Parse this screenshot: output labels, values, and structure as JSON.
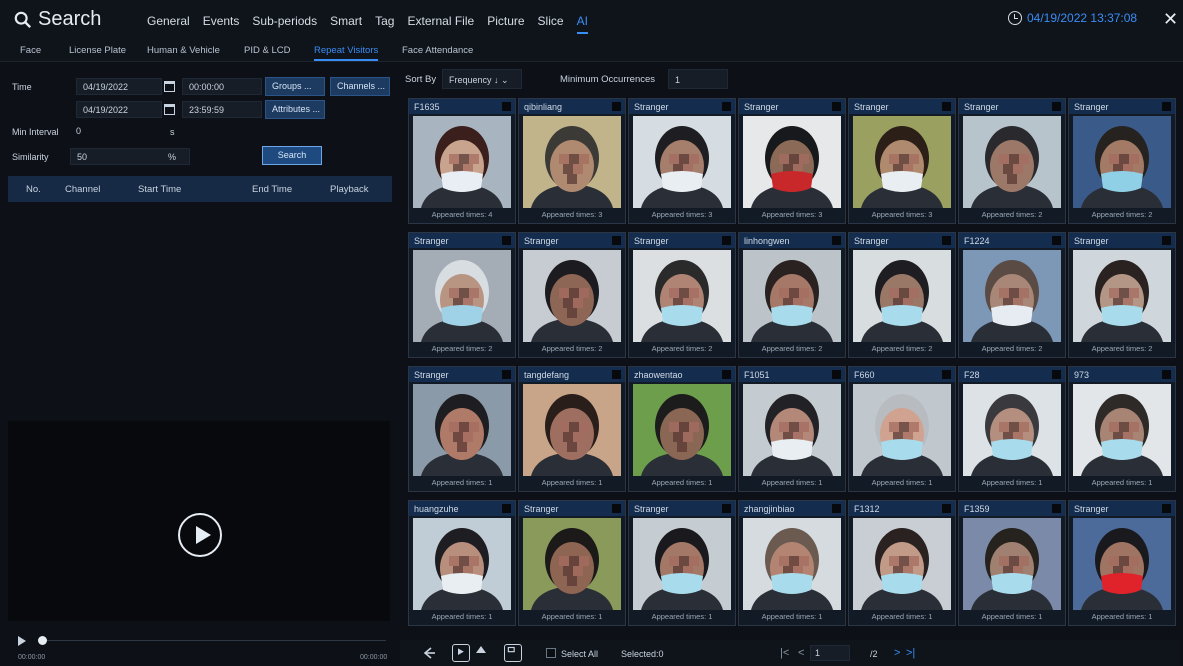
{
  "header": {
    "title": "Search",
    "tabs": [
      "General",
      "Events",
      "Sub-periods",
      "Smart",
      "Tag",
      "External File",
      "Picture",
      "Slice",
      "AI"
    ],
    "active_tab": "AI",
    "datetime": "04/19/2022 13:37:08"
  },
  "subtabs": {
    "items": [
      "Face",
      "License Plate",
      "Human & Vehicle",
      "PID & LCD",
      "Repeat Visitors",
      "Face Attendance"
    ],
    "active": "Repeat Visitors"
  },
  "filters": {
    "time_label": "Time",
    "start_date": "04/19/2022",
    "start_time": "00:00:00",
    "end_date": "04/19/2022",
    "end_time": "23:59:59",
    "groups_button": "Groups ...",
    "channels_button": "Channels ...",
    "attributes_button": "Attributes ...",
    "min_interval_label": "Min Interval",
    "min_interval_value": "0",
    "min_interval_unit": "s",
    "similarity_label": "Similarity",
    "similarity_value": "50",
    "similarity_unit": "%",
    "search_button": "Search"
  },
  "results_table": {
    "headers": [
      "No.",
      "Channel",
      "Start Time",
      "End Time",
      "Playback"
    ]
  },
  "player": {
    "time_start": "00:00:00",
    "time_end": "00:00:00"
  },
  "sort": {
    "label": "Sort By",
    "value": "Frequency ↓",
    "min_occ_label": "Minimum Occurrences",
    "min_occ_value": "1"
  },
  "cards": [
    {
      "name": "F1635",
      "appeared": "Appeared times: 4",
      "skin": "#c8a48e",
      "hair": "#3a1f1c",
      "bg": "#a8b4c0",
      "mask": "#e8eef3"
    },
    {
      "name": "qibinliang",
      "appeared": "Appeared times: 3",
      "skin": "#b08a70",
      "hair": "#3c3a36",
      "bg": "#c2b48a",
      "mask": ""
    },
    {
      "name": "Stranger",
      "appeared": "Appeared times: 3",
      "skin": "#a57e6c",
      "hair": "#1d1d22",
      "bg": "#d6dde2",
      "mask": "#e9eef2"
    },
    {
      "name": "Stranger",
      "appeared": "Appeared times: 3",
      "skin": "#8c6a58",
      "hair": "#18191c",
      "bg": "#e6e8ea",
      "mask": "#c8282a"
    },
    {
      "name": "Stranger",
      "appeared": "Appeared times: 3",
      "skin": "#b08a6f",
      "hair": "#2b1f18",
      "bg": "#9aa060",
      "mask": "#e9eef2"
    },
    {
      "name": "Stranger",
      "appeared": "Appeared times: 2",
      "skin": "#9c7868",
      "hair": "#2a2a2e",
      "bg": "#b8c4cc",
      "mask": ""
    },
    {
      "name": "Stranger",
      "appeared": "Appeared times: 2",
      "skin": "#a27a66",
      "hair": "#26221f",
      "bg": "#3a5a8a",
      "mask": "#8fd0e6"
    },
    {
      "name": "Stranger",
      "appeared": "Appeared times: 2",
      "skin": "#b89482",
      "hair": "#d8dde1",
      "bg": "#a4acb6",
      "mask": "#9fd2e6"
    },
    {
      "name": "Stranger",
      "appeared": "Appeared times: 2",
      "skin": "#8e6656",
      "hair": "#1c1c20",
      "bg": "#c6ccd2",
      "mask": ""
    },
    {
      "name": "Stranger",
      "appeared": "Appeared times: 2",
      "skin": "#b08474",
      "hair": "#2a2a2a",
      "bg": "#dcdfe2",
      "mask": "#a8dced"
    },
    {
      "name": "linhongwen",
      "appeared": "Appeared times: 2",
      "skin": "#a67868",
      "hair": "#2a2220",
      "bg": "#bcc4ca",
      "mask": "#a8dced"
    },
    {
      "name": "Stranger",
      "appeared": "Appeared times: 2",
      "skin": "#9a7868",
      "hair": "#1e1e22",
      "bg": "#d8dde0",
      "mask": "#a8dced"
    },
    {
      "name": "F1224",
      "appeared": "Appeared times: 2",
      "skin": "#a88678",
      "hair": "#5a4c44",
      "bg": "#7c98b6",
      "mask": "#e6ecf1"
    },
    {
      "name": "Stranger",
      "appeared": "Appeared times: 2",
      "skin": "#b49686",
      "hair": "#2a2220",
      "bg": "#cfd6dc",
      "mask": "#a8dced"
    },
    {
      "name": "Stranger",
      "appeared": "Appeared times: 1",
      "skin": "#b07a68",
      "hair": "#1e1e22",
      "bg": "#8b9aa8",
      "mask": ""
    },
    {
      "name": "tangdefang",
      "appeared": "Appeared times: 1",
      "skin": "#9e6e60",
      "hair": "#2a1e1a",
      "bg": "#c8a488",
      "mask": ""
    },
    {
      "name": "zhaowentao",
      "appeared": "Appeared times: 1",
      "skin": "#8a6654",
      "hair": "#1c1c1c",
      "bg": "#6c9e4c",
      "mask": ""
    },
    {
      "name": "F1051",
      "appeared": "Appeared times: 1",
      "skin": "#b48878",
      "hair": "#222226",
      "bg": "#c4ccd2",
      "mask": "#e9eef2"
    },
    {
      "name": "F660",
      "appeared": "Appeared times: 1",
      "skin": "#d0a290",
      "hair": "#b8bcc0",
      "bg": "#c0c8ce",
      "mask": "#a8dced"
    },
    {
      "name": "F28",
      "appeared": "Appeared times: 1",
      "skin": "#b48e7e",
      "hair": "#3a3a3e",
      "bg": "#dde2e6",
      "mask": "#a8dced"
    },
    {
      "name": "973",
      "appeared": "Appeared times: 1",
      "skin": "#a88474",
      "hair": "#2e2a28",
      "bg": "#e2e6e8",
      "mask": "#a8dced"
    },
    {
      "name": "huangzuhe",
      "appeared": "Appeared times: 1",
      "skin": "#b88e7c",
      "hair": "#1e1e22",
      "bg": "#c0ccd6",
      "mask": "#e9eef2"
    },
    {
      "name": "Stranger",
      "appeared": "Appeared times: 1",
      "skin": "#8e6452",
      "hair": "#1c1a18",
      "bg": "#8a9a5a",
      "mask": ""
    },
    {
      "name": "Stranger",
      "appeared": "Appeared times: 1",
      "skin": "#a47866",
      "hair": "#1a1a1e",
      "bg": "#c6cdd2",
      "mask": "#a8dced"
    },
    {
      "name": "zhangjinbiao",
      "appeared": "Appeared times: 1",
      "skin": "#b48472",
      "hair": "#6a5a50",
      "bg": "#d6dbe0",
      "mask": "#a8dced"
    },
    {
      "name": "F1312",
      "appeared": "Appeared times: 1",
      "skin": "#c29a88",
      "hair": "#2a2220",
      "bg": "#c8ced4",
      "mask": "#a8dced"
    },
    {
      "name": "F1359",
      "appeared": "Appeared times: 1",
      "skin": "#a08070",
      "hair": "#26221e",
      "bg": "#7a8aa8",
      "mask": "#a8dced"
    },
    {
      "name": "Stranger",
      "appeared": "Appeared times: 1",
      "skin": "#a07462",
      "hair": "#1a1a1e",
      "bg": "#4c6a9a",
      "mask": "#e0222a"
    }
  ],
  "bottom": {
    "select_all": "Select All",
    "selected": "Selected:0",
    "page_current": "1",
    "page_total": "/2",
    "first_page": "|<",
    "prev_page": "<",
    "next_page": ">",
    "last_page": ">|"
  },
  "colors": {
    "accent": "#3a8df5",
    "card_header": "#142c4e",
    "background": "#0d1117"
  }
}
